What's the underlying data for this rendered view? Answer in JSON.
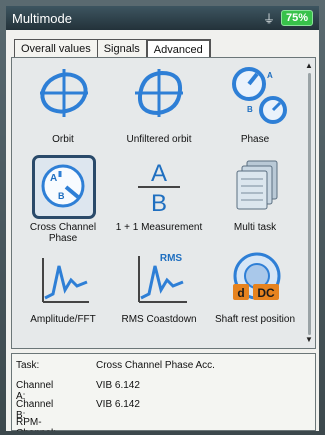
{
  "window": {
    "title": "Multimode",
    "battery": "75%",
    "usb_icon": "usb-icon"
  },
  "tabs": [
    {
      "label": "Overall values",
      "active": false
    },
    {
      "label": "Signals",
      "active": false
    },
    {
      "label": "Advanced",
      "active": true
    }
  ],
  "items": [
    {
      "label": "Orbit",
      "icon": "orbit-icon"
    },
    {
      "label": "Unfiltered orbit",
      "icon": "unfiltered-orbit-icon"
    },
    {
      "label": "Phase",
      "icon": "phase-icon",
      "icon_letters": [
        "A",
        "B"
      ]
    },
    {
      "label_line1": "Cross Channel",
      "label_line2": "Phase",
      "icon": "cross-channel-phase-icon",
      "selected": true,
      "icon_letters": [
        "A",
        "B"
      ]
    },
    {
      "label": "1 + 1 Measurement",
      "icon": "a-over-b-icon",
      "icon_letters": [
        "A",
        "B"
      ]
    },
    {
      "label": "Multi task",
      "icon": "multi-task-icon"
    },
    {
      "label": "Amplitude/FFT",
      "icon": "amplitude-fft-icon"
    },
    {
      "label": "RMS Coastdown",
      "icon": "rms-coastdown-icon",
      "icon_letters": [
        "RMS"
      ]
    },
    {
      "label": "Shaft rest position",
      "icon": "shaft-rest-position-icon",
      "icon_letters": [
        "d",
        "DC"
      ]
    }
  ],
  "info": {
    "task_label": "Task:",
    "task_value": "Cross Channel Phase Acc.",
    "channel_a_label": "Channel A:",
    "channel_a_value": "VIB 6.142",
    "channel_b_label": "Channel B:",
    "channel_b_value": "VIB 6.142",
    "rpm_label": "RPM-Channel:",
    "rpm_value": ""
  },
  "colors": {
    "accent": "#1f6fc0",
    "icon_blue": "#2e7fd6",
    "selection": "#2a4a6a",
    "battery": "#38c24a"
  }
}
